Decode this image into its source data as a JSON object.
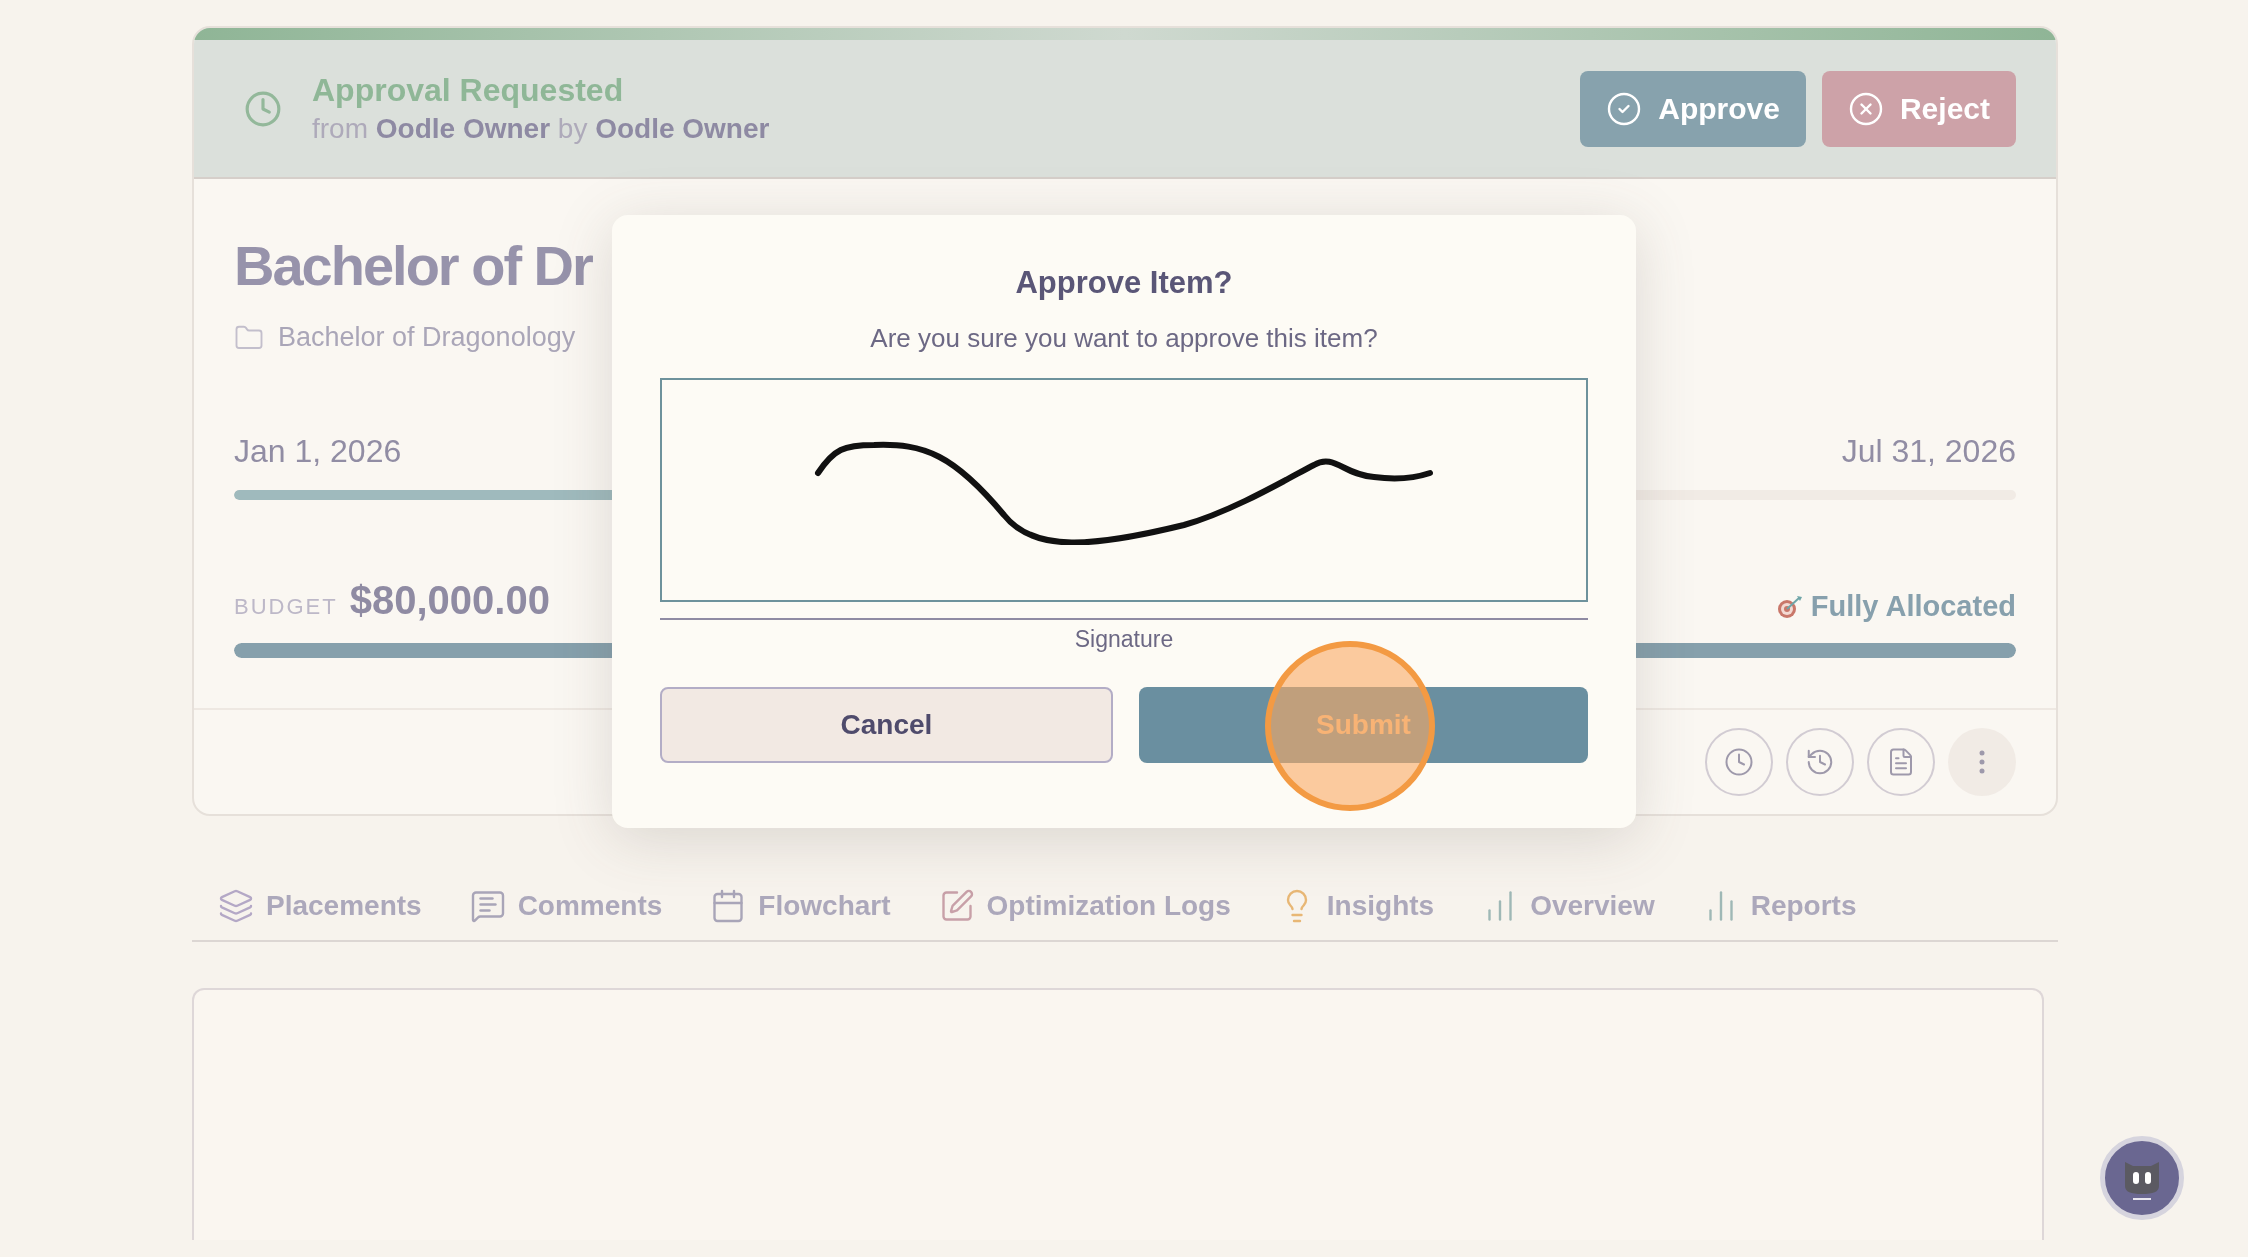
{
  "approval_banner": {
    "title": "Approval Requested",
    "subtitle": "from **Oodle Owner** by **Oodle Owner**",
    "buttons": [
      {
        "kind": "approve",
        "label": "Approve"
      },
      {
        "kind": "reject",
        "label": "Reject"
      }
    ]
  },
  "card": {
    "title": "Bachelor of Dr",
    "folder": "Bachelor of Dragonology",
    "start_date": "Jan 1, 2026",
    "end_date": "Jul 31, 2026",
    "timeline": {
      "level": 0.5
    },
    "budget_label": "BUDGET",
    "budget_value": "$80,000.00",
    "allocation_status": "Fully Allocated",
    "budget_bar": {
      "level": 1
    }
  },
  "tabs": [
    {
      "label": "Placements",
      "selected": false
    },
    {
      "label": "Comments",
      "selected": false
    },
    {
      "label": "Flowchart",
      "selected": false
    },
    {
      "label": "Optimization Logs",
      "selected": false
    },
    {
      "label": "Insights",
      "selected": false
    },
    {
      "label": "Overview",
      "selected": false
    },
    {
      "label": "Reports",
      "selected": false
    }
  ],
  "dialog": {
    "title": "Approve Item?",
    "message": "Are you sure you want to approve this item?",
    "signature_label": "Signature",
    "buttons": [
      {
        "kind": "cancel",
        "label": "Cancel"
      },
      {
        "kind": "submit",
        "label": "Submit",
        "clicked": true
      }
    ]
  }
}
